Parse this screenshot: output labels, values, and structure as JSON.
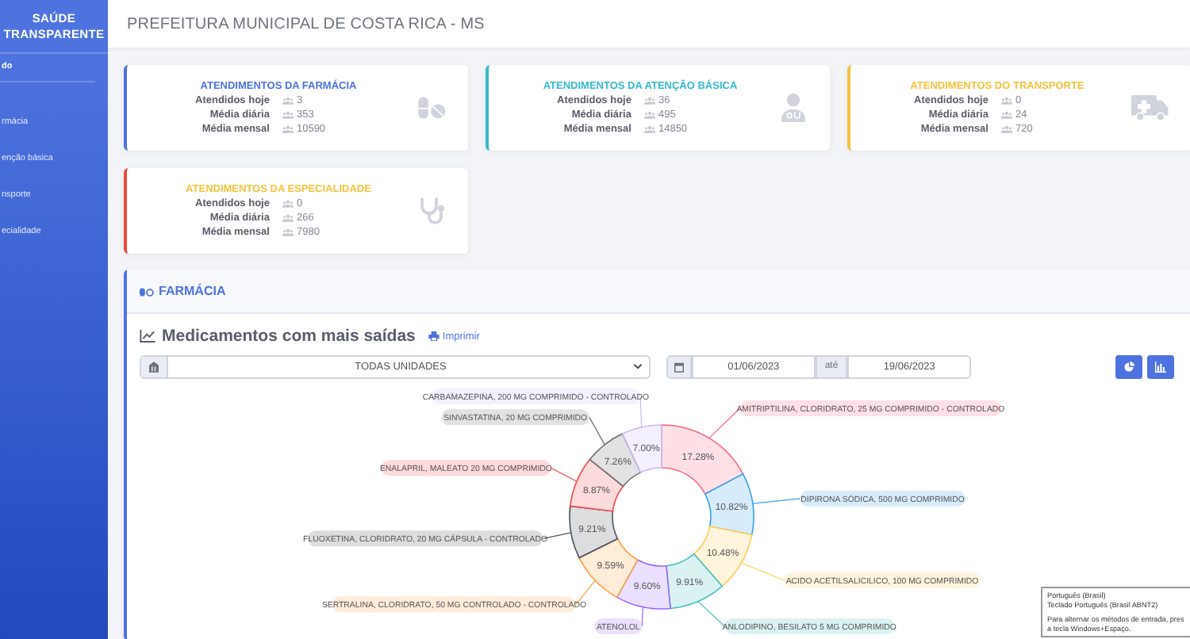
{
  "sidebar": {
    "title_lines": [
      "SAÚDE",
      "TRANSPARENTE"
    ],
    "items": [
      {
        "label": "do",
        "selected": true
      },
      {
        "label": "rmácia",
        "selected": false
      },
      {
        "label": "enção básica",
        "selected": false
      },
      {
        "label": "nsporte",
        "selected": false
      },
      {
        "label": "ecialidade",
        "selected": false
      }
    ]
  },
  "header": {
    "title": "PREFEITURA MUNICIPAL DE COSTA RICA - MS"
  },
  "cards": [
    {
      "kind": "pharmacy",
      "title": {
        "text": "ATENDIMENTOS DA FARMÁCIA",
        "color": "#4e73df"
      },
      "color": "#4e73df",
      "stats": [
        {
          "label": "Atendidos hoje",
          "value": "3"
        },
        {
          "label": "Média diária",
          "value": "353"
        },
        {
          "label": "Média mensal",
          "value": "10590"
        }
      ]
    },
    {
      "kind": "primary-care",
      "title": {
        "text": "ATENDIMENTOS DA ATENÇÃO BÁSICA",
        "color": "#36b9cc"
      },
      "color": "#36b9cc",
      "stats": [
        {
          "label": "Atendidos hoje",
          "value": "36"
        },
        {
          "label": "Média diária",
          "value": "495"
        },
        {
          "label": "Média mensal",
          "value": "14850"
        }
      ]
    },
    {
      "kind": "transport",
      "title": {
        "text": "ATENDIMENTOS DO TRANSPORTE",
        "color": "#f6c23e"
      },
      "color": "#f6c23e",
      "stats": [
        {
          "label": "Atendidos hoje",
          "value": "0"
        },
        {
          "label": "Média diária",
          "value": "24"
        },
        {
          "label": "Média mensal",
          "value": "720"
        }
      ]
    },
    {
      "kind": "specialty",
      "title": {
        "text": "ATENDIMENTOS DA ESPECIALIDADE",
        "color": "#f6c23e"
      },
      "color": "#e74a3b",
      "stats": [
        {
          "label": "Atendidos hoje",
          "value": "0"
        },
        {
          "label": "Média diária",
          "value": "266"
        },
        {
          "label": "Média mensal",
          "value": "7980"
        }
      ]
    }
  ],
  "panel": {
    "title": "FARMÁCIA",
    "chart_title": "Medicamentos com mais saídas",
    "print_link": "Imprimir",
    "unit_select": {
      "value": "TODAS UNIDADES"
    },
    "date_from": {
      "value": "01/06/2023"
    },
    "date_separator": "até",
    "date_to": {
      "value": "19/06/2023"
    },
    "chart_data": {
      "type": "donut",
      "value_labels": [
        "17.28%",
        "10.82%",
        "10.48%",
        "9.91%",
        "9.60%",
        "9.59%",
        "9.21%",
        "8.87%",
        "7.26%",
        "7.00%"
      ],
      "categories": [
        "AMITRIPTILINA, CLORIDRATO, 25 MG  COMPRIMIDO - CONTROLADO",
        "DIPIRONA SÓDICA, 500 MG  COMPRIMIDO",
        "ACIDO ACETILSALICILICO, 100 MG  COMPRIMIDO",
        "ANLODIPINO, BESILATO 5 MG COMPRIMIDO",
        "ATENOLOL",
        "SERTRALINA, CLORIDRATO, 50 MG CONTROLADO - CONTROLADO",
        "FLUOXETINA, CLORIDRATO, 20 MG  CÁPSULA - CONTROLADO",
        "ENALAPRIL, MALEATO 20 MG  COMPRIMIDO",
        "SINVASTATINA, 20 MG  COMPRIMIDO",
        "CARBAMAZEPINA, 200 MG COMPRIMIDO - CONTROLADO"
      ],
      "values": [
        17.28,
        10.82,
        10.48,
        9.91,
        9.6,
        9.59,
        9.21,
        8.87,
        7.26,
        7.0
      ],
      "colors": [
        "#ff6384",
        "#36a2eb",
        "#ffcd56",
        "#4bc0c0",
        "#9966ff",
        "#ff9f40",
        "#4d5360",
        "#f7464a",
        "#6e6e6e",
        "#c9b6f5"
      ]
    }
  },
  "ime_popup": {
    "lines": [
      "Português (Brasil)",
      "Teclado Português (Brasil ABNT2)"
    ],
    "hint_lines": [
      "Para alternar os métodos de entrada, pres",
      "a tecla Windows+Espaço."
    ]
  }
}
